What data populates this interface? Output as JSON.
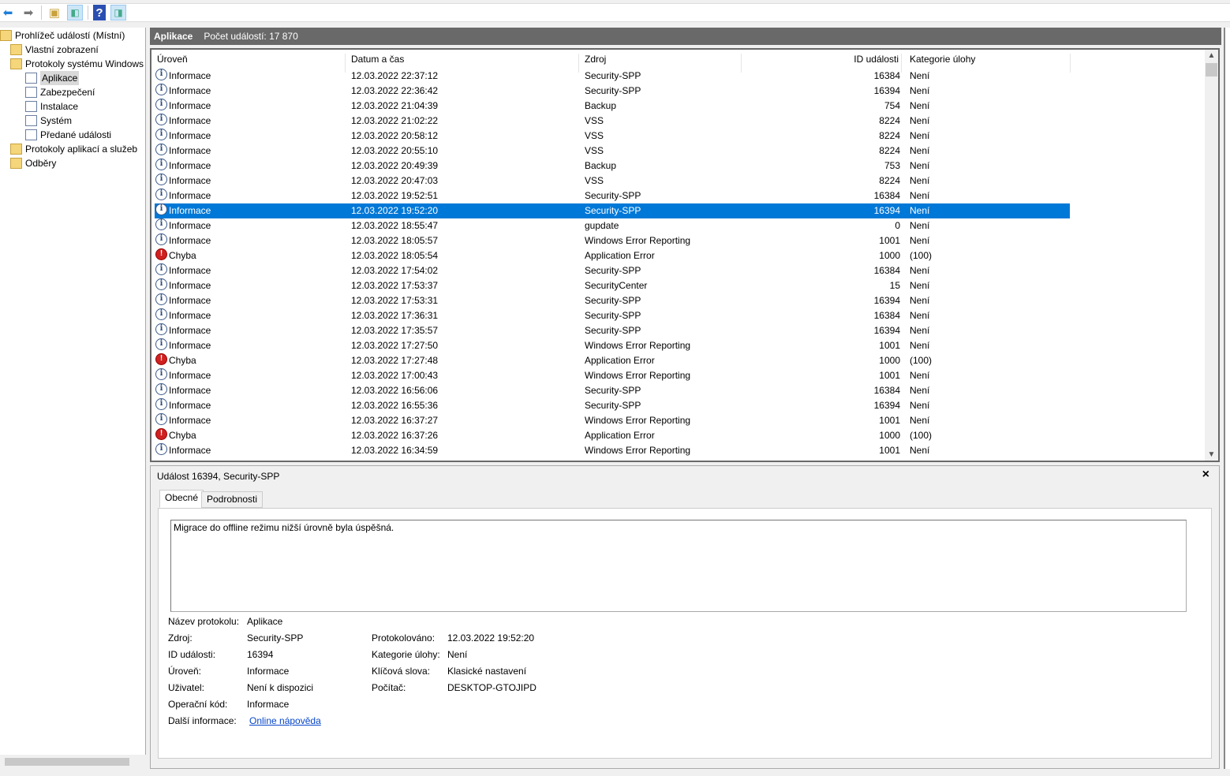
{
  "toolbar": {
    "buttons": [
      "back-arrow-icon",
      "forward-arrow-icon",
      "up-folder-icon",
      "show-hide-console-tree-icon",
      "help-icon",
      "show-hide-action-pane-icon"
    ]
  },
  "tree": {
    "root": "Prohlížeč událostí (Místní)",
    "items": [
      {
        "label": "Vlastní zobrazení"
      },
      {
        "label": "Protokoly systému Windows"
      },
      {
        "label": "Aplikace"
      },
      {
        "label": "Zabezpečení"
      },
      {
        "label": "Instalace"
      },
      {
        "label": "Systém"
      },
      {
        "label": "Předané události"
      },
      {
        "label": "Protokoly aplikací a služeb"
      },
      {
        "label": "Odběry"
      }
    ]
  },
  "header": {
    "title": "Aplikace",
    "count": "Počet událostí: 17 870"
  },
  "columns": [
    "Úroveň",
    "Datum a čas",
    "Zdroj",
    "ID události",
    "Kategorie úlohy"
  ],
  "rows": [
    [
      "Informace",
      "12.03.2022 22:37:12",
      "Security-SPP",
      "16384",
      "Není"
    ],
    [
      "Informace",
      "12.03.2022 22:36:42",
      "Security-SPP",
      "16394",
      "Není"
    ],
    [
      "Informace",
      "12.03.2022 21:04:39",
      "Backup",
      "754",
      "Není"
    ],
    [
      "Informace",
      "12.03.2022 21:02:22",
      "VSS",
      "8224",
      "Není"
    ],
    [
      "Informace",
      "12.03.2022 20:58:12",
      "VSS",
      "8224",
      "Není"
    ],
    [
      "Informace",
      "12.03.2022 20:55:10",
      "VSS",
      "8224",
      "Není"
    ],
    [
      "Informace",
      "12.03.2022 20:49:39",
      "Backup",
      "753",
      "Není"
    ],
    [
      "Informace",
      "12.03.2022 20:47:03",
      "VSS",
      "8224",
      "Není"
    ],
    [
      "Informace",
      "12.03.2022 19:52:51",
      "Security-SPP",
      "16384",
      "Není"
    ],
    [
      "Informace",
      "12.03.2022 19:52:20",
      "Security-SPP",
      "16394",
      "Není"
    ],
    [
      "Informace",
      "12.03.2022 18:55:47",
      "gupdate",
      "0",
      "Není"
    ],
    [
      "Informace",
      "12.03.2022 18:05:57",
      "Windows Error Reporting",
      "1001",
      "Není"
    ],
    [
      "Chyba",
      "12.03.2022 18:05:54",
      "Application Error",
      "1000",
      "(100)"
    ],
    [
      "Informace",
      "12.03.2022 17:54:02",
      "Security-SPP",
      "16384",
      "Není"
    ],
    [
      "Informace",
      "12.03.2022 17:53:37",
      "SecurityCenter",
      "15",
      "Není"
    ],
    [
      "Informace",
      "12.03.2022 17:53:31",
      "Security-SPP",
      "16394",
      "Není"
    ],
    [
      "Informace",
      "12.03.2022 17:36:31",
      "Security-SPP",
      "16384",
      "Není"
    ],
    [
      "Informace",
      "12.03.2022 17:35:57",
      "Security-SPP",
      "16394",
      "Není"
    ],
    [
      "Informace",
      "12.03.2022 17:27:50",
      "Windows Error Reporting",
      "1001",
      "Není"
    ],
    [
      "Chyba",
      "12.03.2022 17:27:48",
      "Application Error",
      "1000",
      "(100)"
    ],
    [
      "Informace",
      "12.03.2022 17:00:43",
      "Windows Error Reporting",
      "1001",
      "Není"
    ],
    [
      "Informace",
      "12.03.2022 16:56:06",
      "Security-SPP",
      "16384",
      "Není"
    ],
    [
      "Informace",
      "12.03.2022 16:55:36",
      "Security-SPP",
      "16394",
      "Není"
    ],
    [
      "Informace",
      "12.03.2022 16:37:27",
      "Windows Error Reporting",
      "1001",
      "Není"
    ],
    [
      "Chyba",
      "12.03.2022 16:37:26",
      "Application Error",
      "1000",
      "(100)"
    ],
    [
      "Informace",
      "12.03.2022 16:34:59",
      "Windows Error Reporting",
      "1001",
      "Není"
    ]
  ],
  "selected_row": 9,
  "detail": {
    "title": "Událost 16394, Security-SPP",
    "tabs": [
      "Obecné",
      "Podrobnosti"
    ],
    "message": "Migrace do offline režimu nižší úrovně byla úspěšná.",
    "left": [
      [
        "Název protokolu:",
        "Aplikace"
      ],
      [
        "Zdroj:",
        "Security-SPP"
      ],
      [
        "ID události:",
        "16394"
      ],
      [
        "Úroveň:",
        "Informace"
      ],
      [
        "Uživatel:",
        "Není k dispozici"
      ],
      [
        "Operační kód:",
        "Informace"
      ],
      [
        "Další informace:",
        "Online nápověda"
      ]
    ],
    "right": [
      [
        "Protokolováno:",
        "12.03.2022 19:52:20"
      ],
      [
        "Kategorie úlohy:",
        "Není"
      ],
      [
        "Klíčová slova:",
        "Klasické nastavení"
      ],
      [
        "Počítač:",
        "DESKTOP-GTOJIPD"
      ]
    ]
  },
  "colors": {
    "selection": "#0078d7",
    "header": "#696969",
    "error": "#d02020",
    "link": "#0645c8"
  }
}
